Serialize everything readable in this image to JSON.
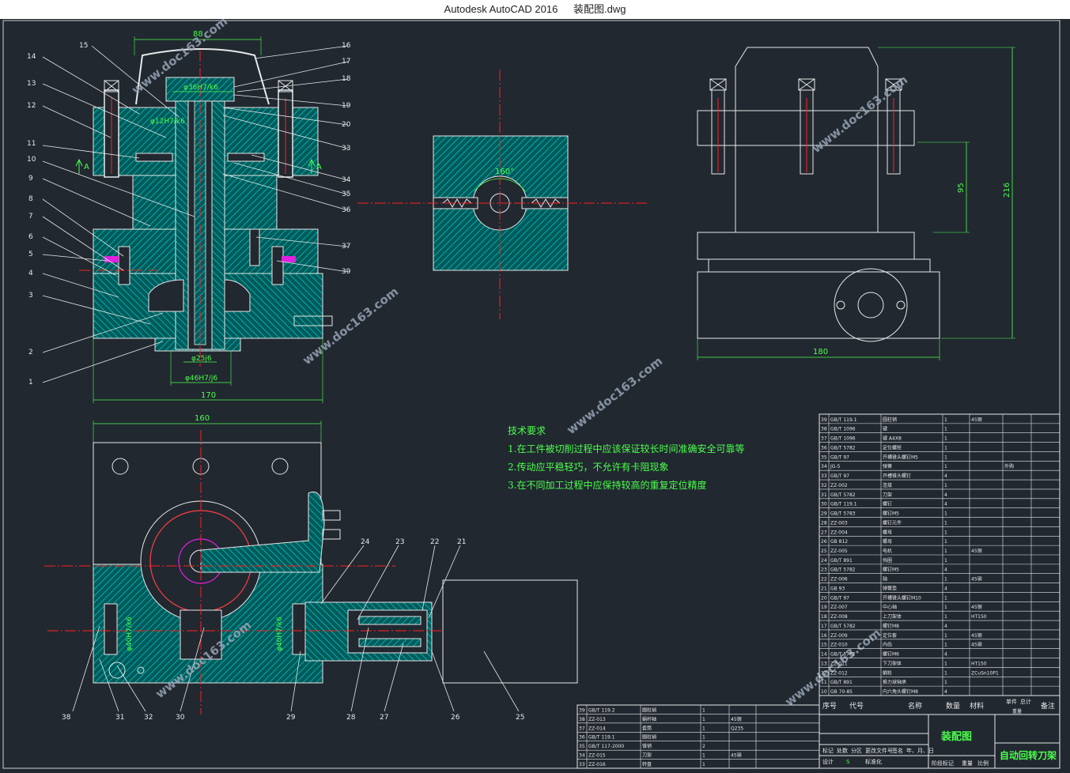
{
  "window": {
    "app_title": "Autodesk AutoCAD 2016",
    "file_name": "装配图.dwg"
  },
  "drawing": {
    "dims": {
      "d88": "88",
      "d36": "φ36H7/k6",
      "d12": "φ12H7/k6",
      "d25": "φ25j6",
      "d46": "φ46H7/j6",
      "d170": "170",
      "d160": "160",
      "d180": "180",
      "d216": "216",
      "d95": "95",
      "angle": "160°",
      "d40a": "φ40H7/k6",
      "d40b": "φ40H7/k6"
    },
    "section_marks": {
      "left": "A",
      "right": "A"
    },
    "balloons_left": [
      "14",
      "13",
      "12",
      "11",
      "10",
      "9",
      "8",
      "7",
      "6",
      "5",
      "4",
      "3",
      "2",
      "1"
    ],
    "balloons_top": [
      "15"
    ],
    "balloons_right": [
      "16",
      "17",
      "18",
      "19",
      "20",
      "33",
      "34",
      "35",
      "36",
      "37",
      "39"
    ],
    "balloons_bottom": [
      "24",
      "23",
      "22",
      "21",
      "38",
      "31",
      "32",
      "30",
      "29",
      "28",
      "27",
      "26",
      "25"
    ],
    "watermark": "www.doc163.com",
    "colors": {
      "background": "#212830",
      "hatch": "#00c8c8",
      "outline": "#e8e8e8",
      "centerline": "#ff2020",
      "note_text": "#4cff4c",
      "magenta": "#e020e0"
    }
  },
  "technical_requirements": {
    "heading": "技术要求",
    "items": [
      "1.在工件被切削过程中应该保证较长时间准确安全可靠等",
      "2.传动应平稳轻巧，不允许有卡阻现象",
      "3.在不同加工过程中应保持较高的重复定位精度"
    ]
  },
  "parts_list": {
    "rows": [
      [
        "39",
        "GB/T 119.1",
        "圆柱销",
        "1",
        "45钢",
        ""
      ],
      [
        "38",
        "GB/T 1096",
        "键",
        "1",
        "",
        ""
      ],
      [
        "37",
        "GB/T 1096",
        "键 A4X8",
        "1",
        "",
        ""
      ],
      [
        "36",
        "GB/T 5782",
        "定位螺栓",
        "1",
        "",
        ""
      ],
      [
        "35",
        "GB/T 97",
        "开槽锥头螺钉M5",
        "1",
        "",
        ""
      ],
      [
        "34",
        "JG-5",
        "弹簧",
        "1",
        "",
        "外购"
      ],
      [
        "33",
        "GB/T 97",
        "开槽锥头螺钉",
        "4",
        "",
        ""
      ],
      [
        "32",
        "ZZ-002",
        "连接",
        "1",
        "",
        ""
      ],
      [
        "31",
        "GB/T 5782",
        "刀架",
        "4",
        "",
        ""
      ],
      [
        "30",
        "GB/T 119.1",
        "螺钉",
        "4",
        "",
        ""
      ],
      [
        "29",
        "GB/T 5783",
        "螺钉M5",
        "1",
        "",
        ""
      ],
      [
        "28",
        "ZZ-003",
        "螺钉元件",
        "1",
        "",
        ""
      ],
      [
        "27",
        "ZZ-004",
        "螺母",
        "1",
        "",
        ""
      ],
      [
        "26",
        "GB 812",
        "螺母",
        "1",
        "",
        ""
      ],
      [
        "25",
        "ZZ-005",
        "电机",
        "1",
        "45钢",
        ""
      ],
      [
        "24",
        "GB/T 891",
        "挡圈",
        "1",
        "",
        ""
      ],
      [
        "23",
        "GB/T 5782",
        "螺钉M5",
        "4",
        "",
        ""
      ],
      [
        "22",
        "ZZ-006",
        "轴",
        "1",
        "45钢",
        ""
      ],
      [
        "21",
        "GB 93",
        "弹簧垫",
        "4",
        "",
        ""
      ],
      [
        "20",
        "GB/T 97",
        "开槽锥头螺钉M10",
        "1",
        "",
        ""
      ],
      [
        "19",
        "ZZ-007",
        "中心轴",
        "1",
        "45钢",
        ""
      ],
      [
        "18",
        "ZZ-008",
        "上刀架体",
        "1",
        "HT150",
        ""
      ],
      [
        "17",
        "GB/T 5782",
        "螺钉M8",
        "4",
        "",
        ""
      ],
      [
        "16",
        "ZZ-009",
        "定位套",
        "1",
        "45钢",
        ""
      ],
      [
        "15",
        "ZZ-010",
        "内齿",
        "1",
        "45钢",
        ""
      ],
      [
        "14",
        "GB/T 5782",
        "螺钉M6",
        "4",
        "",
        ""
      ],
      [
        "13",
        "ZZ-011",
        "下刀架体",
        "1",
        "HT150",
        ""
      ],
      [
        "12",
        "ZZ-012",
        "蜗轮",
        "1",
        "ZCuSn10P1",
        ""
      ],
      [
        "11",
        "GB/T 891",
        "推力球轴承",
        "1",
        "",
        ""
      ],
      [
        "10",
        "GB 70-85",
        "内六角头螺钉M8",
        "4",
        "",
        ""
      ]
    ],
    "header": [
      "序号",
      "代号",
      "名称",
      "数量",
      "材料",
      "单件",
      "总计",
      "备注"
    ],
    "header_sub": "重量",
    "rows2": [
      [
        "39",
        "GB/T 119.2",
        "圆柱销",
        "1",
        "",
        ""
      ],
      [
        "38",
        "ZZ-013",
        "蜗杆轴",
        "1",
        "45钢",
        ""
      ],
      [
        "37",
        "ZZ-014",
        "套筒",
        "1",
        "Q235",
        ""
      ],
      [
        "36",
        "GB/T 119.1",
        "圆柱销",
        "1",
        "",
        ""
      ],
      [
        "35",
        "GB/T 117-2000",
        "锥销",
        "2",
        "",
        ""
      ],
      [
        "34",
        "ZZ-015",
        "刀架",
        "1",
        "45钢",
        ""
      ],
      [
        "33",
        "ZZ-016",
        "转盘",
        "1",
        "",
        ""
      ]
    ],
    "title_block": {
      "drawing_name": "装配图",
      "product_name": "自动回转刀架",
      "row_labels": [
        "标记",
        "处数",
        "分区",
        "更改文件号",
        "签名",
        "年、月、日"
      ],
      "row_labels2": [
        "设计",
        "",
        "标准化"
      ],
      "row_labels3": [
        "阶段标记",
        "重量",
        "比例"
      ],
      "stage": "S"
    }
  }
}
